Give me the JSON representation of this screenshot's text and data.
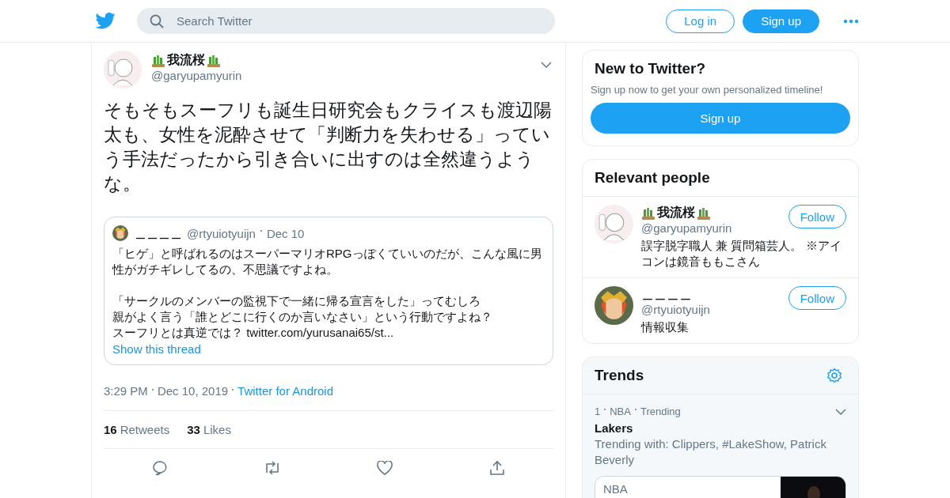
{
  "header": {
    "search": {
      "placeholder": "Search Twitter"
    },
    "buttons": [
      {
        "label": "Log in",
        "kind": "outline"
      },
      {
        "label": "Sign up",
        "kind": "filled"
      }
    ]
  },
  "tweet": {
    "author": {
      "name": "我流桜",
      "handle": "@garyupamyurin"
    },
    "text": "そもそもスーフリも誕生日研究会もクライスも渡辺陽太も、女性を泥酔させて「判断力を失わせる」っていう手法だったから引き合いに出すのは全然違うような。",
    "quote": {
      "name": "＿＿＿＿",
      "handle": "@rtyuiotyuijn",
      "date": "Dec 10",
      "paragraphs": [
        [
          "「ヒゲ」と呼ばれるのはスーパーマリオRPGっぽくていいのだが、こんな風に男性がガチギレしてるの、不思議ですよね。"
        ],
        [
          "「サークルのメンバーの監視下で一緒に帰る宣言をした」ってむしろ",
          "親がよく言う「誰とどこに行くのか言いなさい」という行動ですよね？",
          "スーフリとは真逆では？ twitter.com/yurusanai65/st..."
        ]
      ],
      "thread_link": "Show this thread"
    },
    "time": "3:29 PM",
    "date": "Dec 10, 2019",
    "source": "Twitter for Android",
    "stats": [
      {
        "count": "16",
        "label": "Retweets"
      },
      {
        "count": "33",
        "label": "Likes"
      }
    ]
  },
  "signup_card": {
    "title": "New to Twitter?",
    "text": "Sign up now to get your own personalized timeline!",
    "button": "Sign up"
  },
  "relevant_people": {
    "title": "Relevant people",
    "people": [
      {
        "name": "我流桜",
        "handle": "@garyupamyurin",
        "bio": "誤字脱字職人 兼 質問箱芸人。 ※アイコンは鏡音ももこさん",
        "follow": "Follow",
        "kind": "decorated"
      },
      {
        "name": "＿＿＿＿",
        "handle": "@rtyuiotyuijn",
        "bio": "情報収集",
        "follow": "Follow",
        "kind": "plain"
      }
    ]
  },
  "trends": {
    "title": "Trends",
    "items": [
      {
        "rank": "1",
        "category": "NBA",
        "status": "Trending",
        "name": "Lakers",
        "context": "Trending with: Clippers, #LakeShow, Patrick Beverly",
        "card": {
          "source": "NBA",
          "kind": "picture"
        }
      }
    ]
  }
}
